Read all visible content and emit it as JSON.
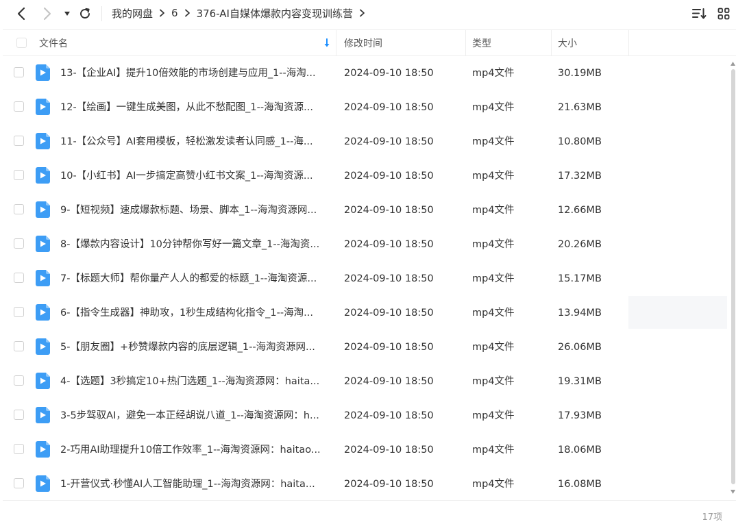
{
  "breadcrumb": {
    "items": [
      "我的网盘",
      "6",
      "376-AI自媒体爆款内容变现训练营"
    ]
  },
  "icons": {
    "back": "chevron-left-icon",
    "forward": "chevron-right-icon",
    "history": "caret-down-icon",
    "refresh": "refresh-icon",
    "sort": "sort-icon",
    "grid": "grid-view-icon",
    "file": "video-file-icon"
  },
  "colors": {
    "accent": "#1e90ff",
    "file_icon": "#3d9df5"
  },
  "columns": {
    "name": "文件名",
    "modified": "修改时间",
    "type": "类型",
    "size": "大小"
  },
  "files": [
    {
      "name": "13-【企业AI】提升10倍效能的市场创建与应用_1--海淘...",
      "modified": "2024-09-10 18:50",
      "type": "mp4文件",
      "size": "30.19MB"
    },
    {
      "name": "12-【绘画】一键生成美图，从此不愁配图_1--海淘资源...",
      "modified": "2024-09-10 18:50",
      "type": "mp4文件",
      "size": "21.63MB"
    },
    {
      "name": "11-【公众号】AI套用模板，轻松激发读者认同感_1--海...",
      "modified": "2024-09-10 18:50",
      "type": "mp4文件",
      "size": "10.80MB"
    },
    {
      "name": "10-【小红书】AI一步搞定高赞小红书文案_1--海淘资源...",
      "modified": "2024-09-10 18:50",
      "type": "mp4文件",
      "size": "17.32MB"
    },
    {
      "name": "9-【短视频】速成爆款标题、场景、脚本_1--海淘资源网...",
      "modified": "2024-09-10 18:50",
      "type": "mp4文件",
      "size": "12.66MB"
    },
    {
      "name": "8-【爆款内容设计】10分钟帮你写好一篇文章_1--海淘资...",
      "modified": "2024-09-10 18:50",
      "type": "mp4文件",
      "size": "20.26MB"
    },
    {
      "name": "7-【标题大师】帮你量产人人的都爱的标题_1--海淘资源...",
      "modified": "2024-09-10 18:50",
      "type": "mp4文件",
      "size": "15.17MB"
    },
    {
      "name": "6-【指令生成器】神助攻，1秒生成结构化指令_1--海淘...",
      "modified": "2024-09-10 18:50",
      "type": "mp4文件",
      "size": "13.94MB"
    },
    {
      "name": "5-【朋友圈】+秒赞爆款内容的底层逻辑_1--海淘资源网...",
      "modified": "2024-09-10 18:50",
      "type": "mp4文件",
      "size": "26.06MB"
    },
    {
      "name": "4-【选题】3秒搞定10+热门选题_1--海淘资源网：haita...",
      "modified": "2024-09-10 18:50",
      "type": "mp4文件",
      "size": "19.31MB"
    },
    {
      "name": "3-5步驾驭AI，避免一本正经胡说八道_1--海淘资源网：h...",
      "modified": "2024-09-10 18:50",
      "type": "mp4文件",
      "size": "17.93MB"
    },
    {
      "name": "2-巧用AI助理提升10倍工作效率_1--海淘资源网：haitao...",
      "modified": "2024-09-10 18:50",
      "type": "mp4文件",
      "size": "18.06MB"
    },
    {
      "name": "1-开营仪式·秒懂AI人工智能助理_1--海淘资源网：haita...",
      "modified": "2024-09-10 18:50",
      "type": "mp4文件",
      "size": "16.08MB"
    }
  ],
  "footer": {
    "count": "17项"
  }
}
